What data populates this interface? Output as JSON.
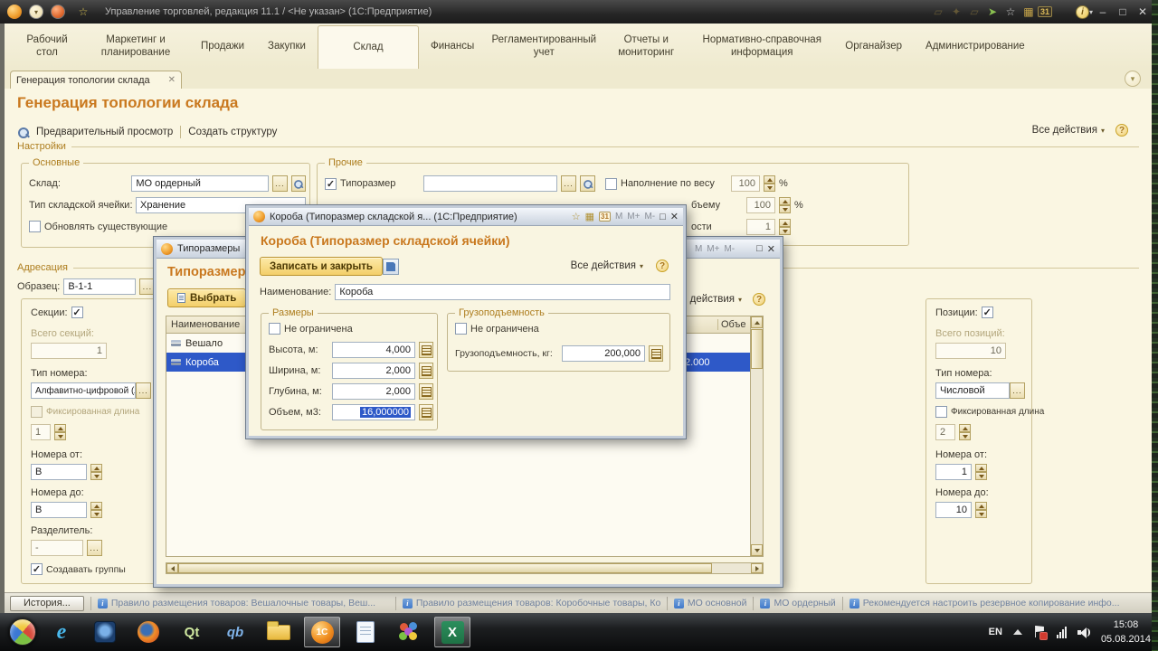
{
  "icons": {
    "close": "✕",
    "minimize": "–",
    "maximize": "□",
    "dropdown": "▾",
    "check": "✓",
    "ellipsis": "...",
    "star": "☆",
    "calendar": "31",
    "info": "i",
    "help": "?",
    "mem": "М",
    "mem_plus": "М+",
    "mem_minus": "М-"
  },
  "colors": {
    "accent_orange": "#c9781e",
    "selection_blue": "#2e59c8",
    "button_yellow": "#f3cf6a",
    "cream_bg": "#faf6e2"
  },
  "titlebar": {
    "title": "Управление торговлей, редакция 11.1 / <Не указан>  (1С:Предприятие)"
  },
  "menu": {
    "tabs": [
      "Рабочий стол",
      "Маркетинг и планирование",
      "Продажи",
      "Закупки",
      "Склад",
      "Финансы",
      "Регламентированный учет",
      "Отчеты и мониторинг",
      "Нормативно-справочная информация",
      "Органайзер",
      "Администрирование"
    ]
  },
  "doc_tab": {
    "label": "Генерация топологии склада"
  },
  "main": {
    "page_title": "Генерация топологии склада",
    "toolbar": {
      "preview": "Предварительный просмотр",
      "create_structure": "Создать структуру",
      "all_actions": "Все действия"
    },
    "sections": {
      "settings": "Настройки",
      "addressing": "Адресация"
    },
    "basic": {
      "legend": "Основные",
      "warehouse_label": "Склад:",
      "warehouse_value": "МО ордерный",
      "cell_type_label": "Тип складской ячейки:",
      "cell_type_value": "Хранение",
      "update_existing_label": "Обновлять существующие"
    },
    "other": {
      "legend": "Прочие",
      "typesize_label": "Типоразмер",
      "typesize_value": "",
      "fill_weight_label": "Наполнение по весу",
      "fill_weight_value": "100",
      "percent": "%",
      "fill_volume_label_fragment": "бъему",
      "fill_volume_value": "100",
      "capacity_label_fragment": "ости",
      "capacity_value": "1"
    },
    "sample": {
      "label": "Образец:",
      "value": "В-1-1"
    },
    "sections_panel": {
      "title": "Секции:",
      "total_label": "Всего секций:",
      "total_value": "1",
      "number_type_label": "Тип номера:",
      "number_type_value": "Алфавитно-цифровой (лат.)",
      "fixed_length_label": "Фиксированная длина",
      "fixed_length_value": "1",
      "from_label": "Номера от:",
      "from_value": "В",
      "to_label": "Номера до:",
      "to_value": "В",
      "separator_label": "Разделитель:",
      "separator_value": "-",
      "create_groups_label": "Создавать группы"
    },
    "positions_panel": {
      "title": "Позиции:",
      "total_label": "Всего позиций:",
      "total_value": "10",
      "number_type_label": "Тип номера:",
      "number_type_value": "Числовой",
      "fixed_length_label": "Фиксированная длина",
      "fixed_length_value": "2",
      "from_label": "Номера от:",
      "from_value": "1",
      "to_label": "Номера до:",
      "to_value": "10"
    }
  },
  "dialog_typesizes": {
    "window_title": "Типоразмеры",
    "header": "Типоразмеры",
    "select_button": "Выбрать",
    "all_actions": "Все действия",
    "columns": {
      "name": "Наименование",
      "volume": "Объе"
    },
    "rows": [
      {
        "name": "Вешало",
        "value": ""
      },
      {
        "name": "Короба",
        "value": "2.000"
      }
    ]
  },
  "dialog_koroba": {
    "window_title": "Короба (Типоразмер складской я...  (1С:Предприятие)",
    "header": "Короба (Типоразмер складской ячейки)",
    "save_close_button": "Записать и закрыть",
    "all_actions": "Все действия",
    "name_label": "Наименование:",
    "name_value": "Короба",
    "sizes": {
      "legend": "Размеры",
      "unlimited_label": "Не ограничена",
      "rows": [
        {
          "label": "Высота, м:",
          "value": "4,000"
        },
        {
          "label": "Ширина, м:",
          "value": "2,000"
        },
        {
          "label": "Глубина, м:",
          "value": "2,000"
        },
        {
          "label": "Объем, м3:",
          "value": "16,000000"
        }
      ]
    },
    "capacity": {
      "legend": "Грузоподъемность",
      "unlimited_label": "Не ограничена",
      "label": "Грузоподъемность, кг:",
      "value": "200,000"
    }
  },
  "statusbar": {
    "history_button": "История...",
    "items": [
      "Правило размещения товаров: Вешалочные товары, Веш...",
      "Правило размещения товаров: Коробочные товары, Кор...",
      "МО основной",
      "МО ордерный",
      "Рекомендуется настроить резервное копирование инфо..."
    ]
  },
  "taskbar": {
    "language": "EN",
    "time": "15:08",
    "date": "05.08.2014",
    "app_labels": {
      "ie": "e",
      "qt": "Qt",
      "qb": "qb",
      "one_c": "1С",
      "excel": "X"
    }
  }
}
